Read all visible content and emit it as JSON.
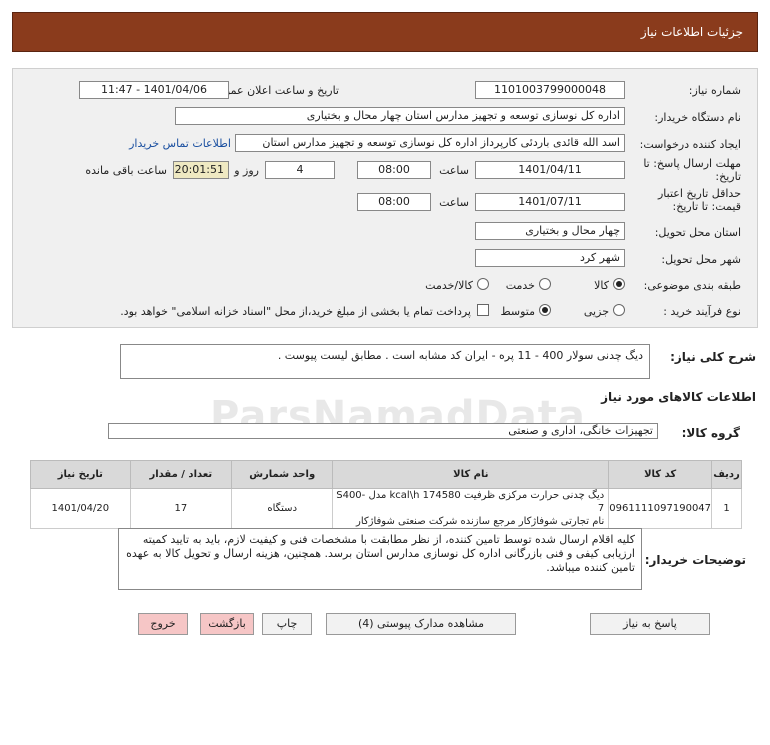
{
  "header": {
    "title": "جزئیات اطلاعات نیاز"
  },
  "form": {
    "need_number_label": "شماره نیاز:",
    "need_number": "1101003799000048",
    "announce_label": "تاریخ و ساعت اعلان عمومی:",
    "announce_value": "1401/04/06 - 11:47",
    "buyer_label": "نام دستگاه خریدار:",
    "buyer_value": "اداره کل نوسازی  توسعه و تجهیز مدارس استان چهار محال و بختیاری",
    "creator_label": "ایجاد کننده درخواست:",
    "creator_value": "اسد الله قائدی باردئی کارپرداز اداره کل نوسازی  توسعه و تجهیز مدارس استان",
    "contact_link": "اطلاعات تماس خریدار",
    "deadline_label_1": "مهلت ارسال پاسخ: تا",
    "deadline_label_2": "تاریخ:",
    "deadline_date": "1401/04/11",
    "time_label": "ساعت",
    "deadline_time": "08:00",
    "days_value": "4",
    "days_label": "روز و",
    "remaining_time": "20:01:51",
    "remaining_label": "ساعت باقی مانده",
    "validity_label_1": "حداقل تاریخ اعتبار",
    "validity_label_2": "قیمت: تا تاریخ:",
    "validity_date": "1401/07/11",
    "validity_time": "08:00",
    "province_label": "استان محل تحویل:",
    "province_value": "چهار محال و بختیاری",
    "city_label": "شهر محل تحویل:",
    "city_value": "شهر کرد",
    "category_label": "طبقه بندی موضوعی:",
    "category_options": [
      "کالا",
      "خدمت",
      "کالا/خدمت"
    ],
    "process_label": "نوع فرآیند خرید :",
    "process_options": [
      "جزیی",
      "متوسط"
    ],
    "payment_note": "پرداخت تمام یا بخشی از مبلغ خرید،از محل \"اسناد خزانه اسلامی\" خواهد بود."
  },
  "description": {
    "label": "شرح کلی نیاز:",
    "value": "دیگ چدنی سولار 400 - 11 پره - ایران کد مشابه است . مطابق لیست پیوست ."
  },
  "goods": {
    "section_title": "اطلاعات کالاهای مورد نیاز",
    "group_label": "گروه کالا:",
    "group_value": "تجهیزات خانگی، اداری و صنعتی"
  },
  "table": {
    "headers": [
      "ردیف",
      "کد کالا",
      "نام کالا",
      "واحد شمارش",
      "تعداد / مقدار",
      "تاریخ نیاز"
    ],
    "rows": [
      {
        "index": "1",
        "code": "0961111097190047",
        "name_line1": "دیگ چدنی حرارت مرکزی ظرفیت 174580 kcal\\h مدل S400-7",
        "name_line2": "نام تجارتی شوفاژکار مرجع سازنده شرکت صنعتی شوفاژکار",
        "unit": "دستگاه",
        "qty": "17",
        "date": "1401/04/20"
      }
    ]
  },
  "notes": {
    "label": "توضیحات خریدار:",
    "value": "کلیه اقلام ارسال شده توسط تامین کننده، از نظر مطابقت با مشخصات فنی و کیفیت لازم، باید به تایید کمیته ارزیابی کیفی و فنی بازرگانی  اداره کل نوسازی مدارس استان برسد. همچنین، هزینه ارسال و تحویل کالا به عهده تامین کننده میباشد."
  },
  "buttons": {
    "reply": "پاسخ به نیاز",
    "docs": "مشاهده مدارک پیوستی (4)",
    "print": "چاپ",
    "back": "بازگشت",
    "exit": "خروج"
  },
  "watermark": "ParsNamadData",
  "colors": {
    "header_bg": "#8a3b1c",
    "panel_bg": "#f0f0f0",
    "link": "#1a4fa0",
    "pink_button": "#f6c6c6"
  }
}
